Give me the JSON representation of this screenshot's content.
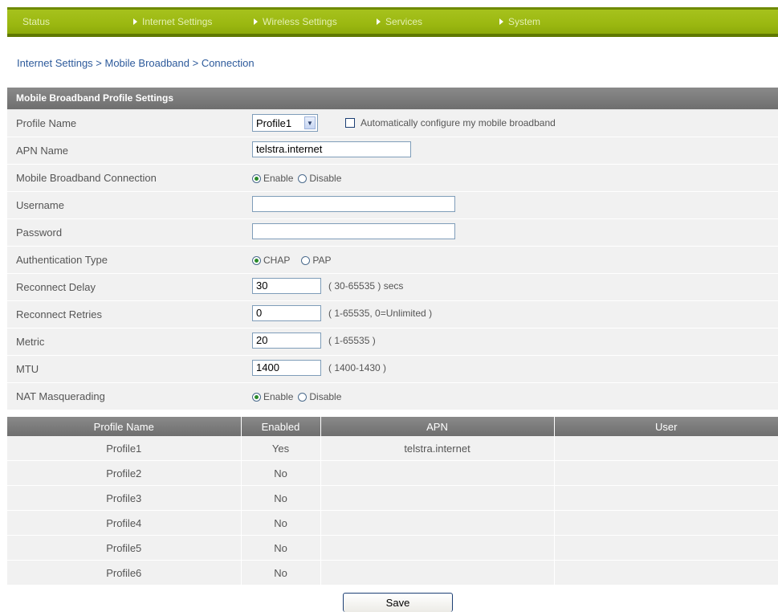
{
  "nav": [
    {
      "label": "Status",
      "arrow": false
    },
    {
      "label": "Internet Settings",
      "arrow": true
    },
    {
      "label": "Wireless Settings",
      "arrow": true
    },
    {
      "label": "Services",
      "arrow": true
    },
    {
      "label": "System",
      "arrow": true
    }
  ],
  "breadcrumb": "Internet Settings > Mobile Broadband > Connection",
  "panel": {
    "title": "Mobile Broadband Profile Settings",
    "profile_name_label": "Profile Name",
    "profile_select_value": "Profile1",
    "auto_config_label": "Automatically configure my mobile broadband",
    "apn_label": "APN Name",
    "apn_value": "telstra.internet",
    "connection_label": "Mobile Broadband Connection",
    "enable_label": "Enable",
    "disable_label": "Disable",
    "username_label": "Username",
    "username_value": "",
    "password_label": "Password",
    "password_value": "",
    "auth_label": "Authentication Type",
    "chap_label": "CHAP",
    "pap_label": "PAP",
    "reconnect_delay_label": "Reconnect Delay",
    "reconnect_delay_value": "30",
    "reconnect_delay_hint": "( 30-65535 ) secs",
    "reconnect_retries_label": "Reconnect Retries",
    "reconnect_retries_value": "0",
    "reconnect_retries_hint": "( 1-65535, 0=Unlimited )",
    "metric_label": "Metric",
    "metric_value": "20",
    "metric_hint": "( 1-65535 )",
    "mtu_label": "MTU",
    "mtu_value": "1400",
    "mtu_hint": "( 1400-1430 )",
    "nat_label": "NAT Masquerading"
  },
  "profiles_table": {
    "headers": [
      "Profile Name",
      "Enabled",
      "APN",
      "User"
    ],
    "rows": [
      [
        "Profile1",
        "Yes",
        "telstra.internet",
        ""
      ],
      [
        "Profile2",
        "No",
        "",
        ""
      ],
      [
        "Profile3",
        "No",
        "",
        ""
      ],
      [
        "Profile4",
        "No",
        "",
        ""
      ],
      [
        "Profile5",
        "No",
        "",
        ""
      ],
      [
        "Profile6",
        "No",
        "",
        ""
      ]
    ]
  },
  "save_label": "Save",
  "colors": {
    "nav_green": "#9bb811",
    "header_gray": "#7c7c7c",
    "row_bg": "#f1f1f1",
    "link_blue": "#2d5a9b"
  }
}
